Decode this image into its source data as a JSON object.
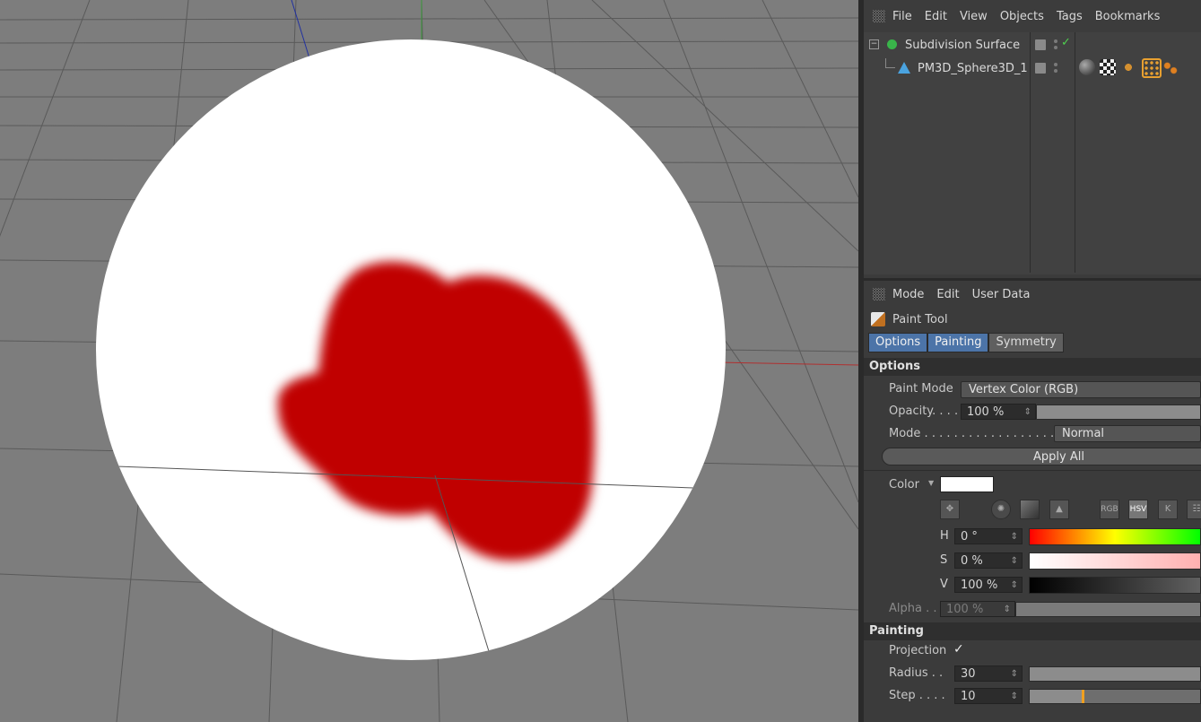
{
  "object_manager": {
    "menu": [
      "File",
      "Edit",
      "View",
      "Objects",
      "Tags",
      "Bookmarks"
    ],
    "objects": [
      {
        "name": "Subdivision Surface"
      },
      {
        "name": "PM3D_Sphere3D_1"
      }
    ]
  },
  "attribute_manager": {
    "menu": [
      "Mode",
      "Edit",
      "User Data"
    ],
    "tool_name": "Paint Tool",
    "tabs": [
      "Options",
      "Painting",
      "Symmetry"
    ],
    "options": {
      "section_title": "Options",
      "paint_mode_label": "Paint Mode",
      "paint_mode_value": "Vertex Color (RGB)",
      "opacity_label": "Opacity. . . .",
      "opacity_value": "100 %",
      "mode_label": "Mode . . . . . . . . . . . . . . . . . .",
      "mode_value": "Normal",
      "apply_all": "Apply All",
      "color_label": "Color",
      "color_value": "#ffffff",
      "color_modes": [
        "RGB",
        "HSV",
        "K"
      ],
      "h_label": "H",
      "h_value": "0 °",
      "s_label": "S",
      "s_value": "0 %",
      "v_label": "V",
      "v_value": "100 %",
      "alpha_label": "Alpha . .",
      "alpha_value": "100 %"
    },
    "painting": {
      "section_title": "Painting",
      "projection_label": "Projection",
      "projection_check": "✓",
      "radius_label": "Radius . .",
      "radius_value": "30",
      "step_label": "Step . . . .",
      "step_value": "10"
    }
  },
  "viewport": {
    "sphere_color": "#ffffff",
    "paint_color": "#c00000",
    "floor_color": "#7d7d7d"
  }
}
